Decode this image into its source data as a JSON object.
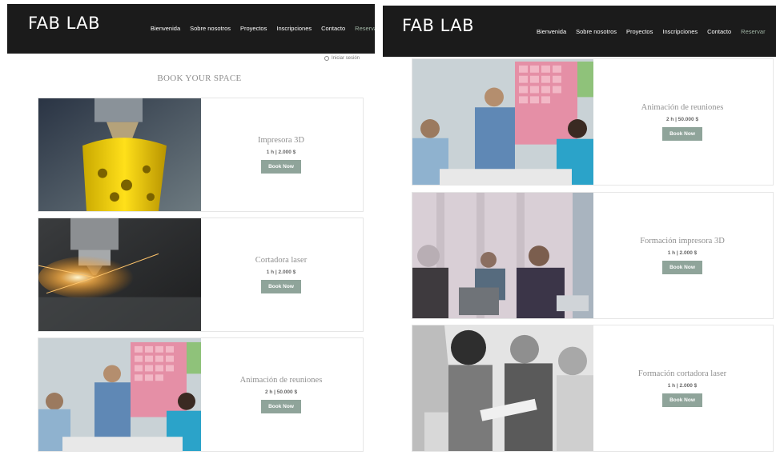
{
  "brand": "FAB LAB",
  "nav": [
    "Bienvenida",
    "Sobre nosotros",
    "Proyectos",
    "Inscripciones",
    "Contacto",
    "Reservar"
  ],
  "login_label": "Iniciar sesión",
  "page_title": "BOOK YOUR SPACE",
  "left_cards": [
    {
      "name": "Impresora 3D",
      "meta": "1 h  |  2.000 $",
      "button": "Book Now"
    },
    {
      "name": "Cortadora laser",
      "meta": "1 h  |  2.000 $",
      "button": "Book Now"
    },
    {
      "name": "Animación de reuniones",
      "meta": "2 h  |  50.000 $",
      "button": "Book Now"
    }
  ],
  "right_cards": [
    {
      "name": "Animación de reuniones",
      "meta": "2 h  |  50.000 $",
      "button": "Book Now"
    },
    {
      "name": "Formación impresora 3D",
      "meta": "1 h  |  2.000 $",
      "button": "Book Now"
    },
    {
      "name": "Formación cortadora laser",
      "meta": "1 h  |  2.000 $",
      "button": "Book Now"
    }
  ],
  "colors": {
    "header_bg": "#1b1b1b",
    "button_bg": "#8fa49a",
    "active_nav": "#9fb3a3"
  }
}
